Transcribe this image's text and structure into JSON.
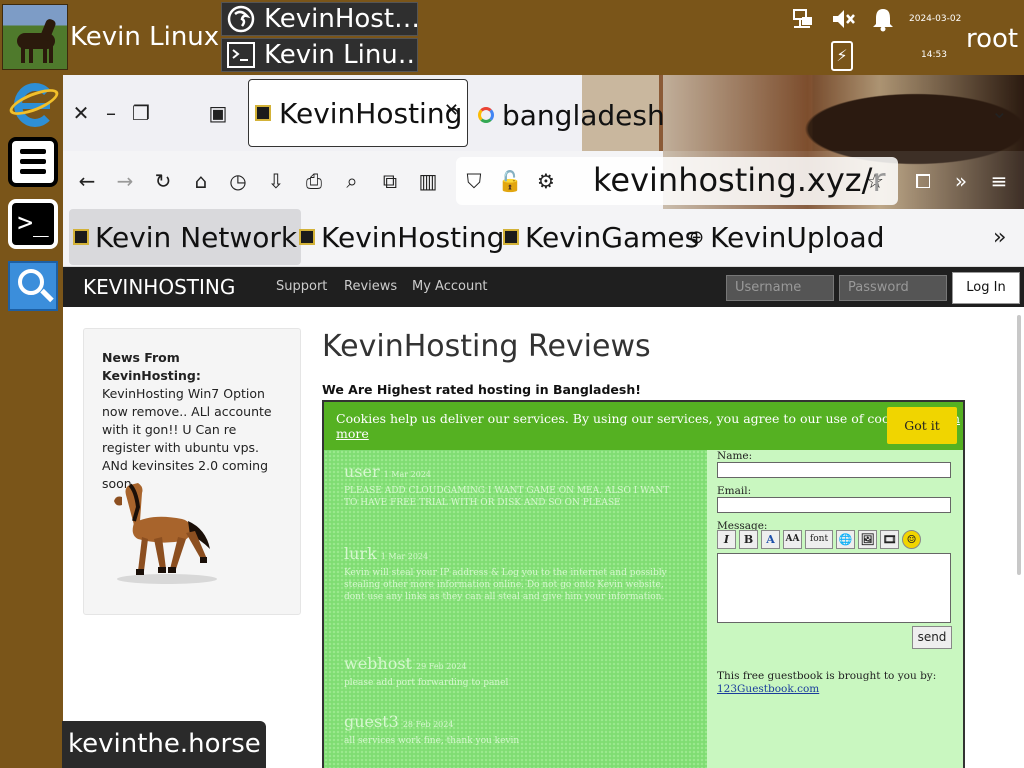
{
  "panel": {
    "username": "Kevin Linux",
    "tasks": [
      "KevinHost…",
      "Kevin Linu…"
    ],
    "date": "2024-03-02",
    "time": "14:53",
    "user": "root"
  },
  "dock": [
    "internet-explorer",
    "file-manager",
    "terminal",
    "search"
  ],
  "browser": {
    "tabs": [
      {
        "label": "KevinHosting",
        "active": true
      },
      {
        "label": "bangladesh",
        "active": false
      }
    ],
    "url_main": "kevinhosting.xyz/",
    "url_fade": "r",
    "bookmarks": [
      "Kevin Network",
      "KevinHosting",
      "KevinGames",
      "KevinUpload"
    ]
  },
  "site": {
    "brand": "KEVINHOSTING",
    "nav": [
      "Support",
      "Reviews",
      "My Account"
    ],
    "username_placeholder": "Username",
    "password_placeholder": "Password",
    "login": "Log In",
    "news_head": "News From KevinHosting:",
    "news_body": "KevinHosting Win7 Option now remove.. ALl accounte with it gon!! U Can re register with ubuntu vps. ANd kevinsites 2.0 coming soon",
    "title": "KevinHosting Reviews",
    "tagline": "We Are Highest rated hosting in Bangladesh!"
  },
  "guestbook": {
    "cookie_text": "Cookies help us deliver our services. By using our services, you agree to our use of cookies.",
    "cookie_link": "Learn more",
    "cookie_btn": "Got it",
    "entries": [
      {
        "who": "user",
        "when": "1 Mar 2024",
        "msg": "PLEASE ADD CLOUDGAMING I WANT GAME ON MEA. ALSO I WANT TO HAVE FREE TRIAL WITH OR DISK AND SO ON PLEASE"
      },
      {
        "who": "lurk",
        "when": "1 Mar 2024",
        "msg": "Kevin will steal your IP address & Log you to the internet and possibly stealing other more information online. Do not go onto Kevin website, dont use any links as they can all steal and give him your information."
      },
      {
        "who": "webhost",
        "when": "29 Feb 2024",
        "msg": "please add port forwarding to panel"
      },
      {
        "who": "guest3",
        "when": "28 Feb 2024",
        "msg": "all services work fine, thank you kevin"
      }
    ],
    "name_label": "Name:",
    "email_label": "Email:",
    "message_label": "Message:",
    "toolbar": [
      "I",
      "B",
      "A",
      "AA",
      "font",
      "🌐",
      "🖼",
      "🎞",
      "☺"
    ],
    "send": "send",
    "credit": "This free guestbook is brought to you by:",
    "credit_link": "123Guestbook.com"
  },
  "bottom_label": "kevinthe.horse"
}
